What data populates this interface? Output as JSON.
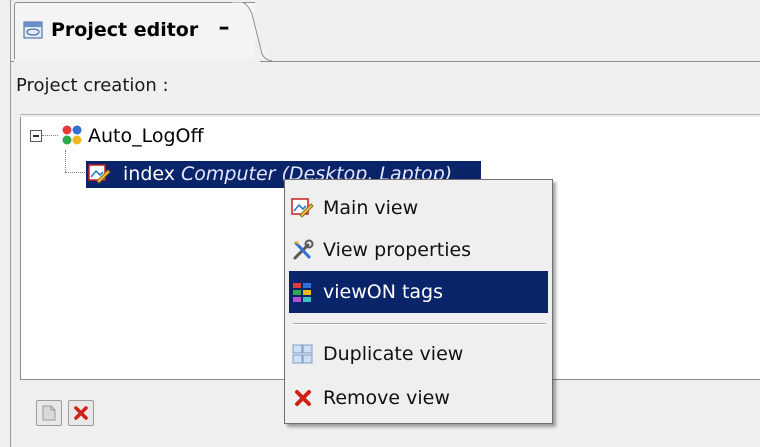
{
  "editor_tab": {
    "title": "Project editor",
    "close_symbol": "–",
    "icon": "window-icon"
  },
  "panel": {
    "label": "Project creation :"
  },
  "tree": {
    "root": {
      "label": "Auto_LogOff",
      "icon": "project-icon",
      "expanded": true
    },
    "child": {
      "name": "index",
      "context": "Computer (Desktop, Laptop)",
      "icon": "view-icon",
      "selected": true
    }
  },
  "toolbar": {
    "buttons": [
      {
        "name": "new-view-button",
        "icon": "new-document-icon",
        "enabled": false
      },
      {
        "name": "remove-button",
        "icon": "red-x-icon",
        "enabled": true
      }
    ]
  },
  "context_menu": {
    "items": [
      {
        "label": "Main view",
        "icon": "view-icon"
      },
      {
        "label": "View properties",
        "icon": "tools-icon"
      },
      {
        "label": "viewON tags",
        "icon": "tags-icon",
        "highlighted": true
      },
      {
        "label": "Duplicate view",
        "icon": "duplicate-icon",
        "disabled_look": true
      },
      {
        "label": "Remove view",
        "icon": "red-x-icon"
      }
    ]
  },
  "colors": {
    "selection": "#0a246a",
    "background": "#efefef",
    "remove_red": "#d0201a"
  }
}
